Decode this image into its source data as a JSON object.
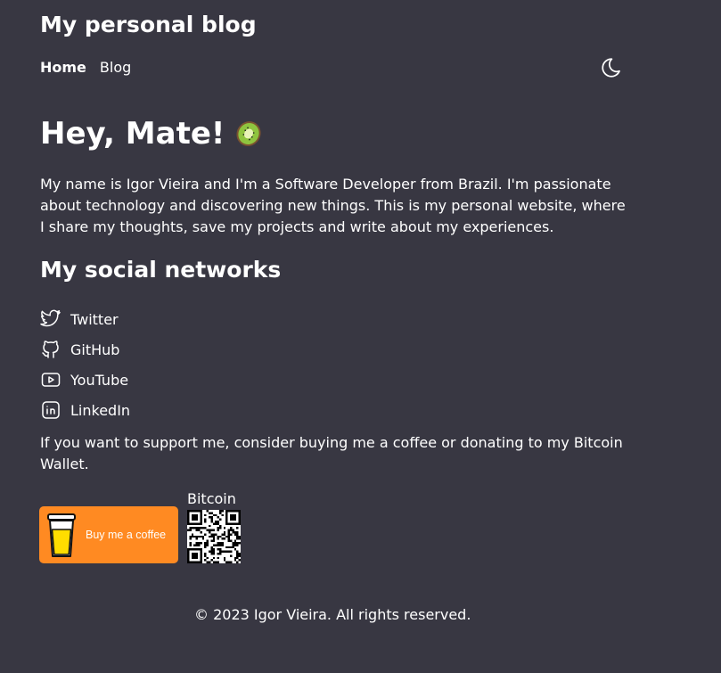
{
  "header": {
    "site_title": "My personal blog",
    "nav": [
      {
        "label": "Home",
        "active": true
      },
      {
        "label": "Blog",
        "active": false
      }
    ],
    "theme_toggle_icon": "moon-icon"
  },
  "hero": {
    "title": "Hey, Mate!",
    "emoji_icon": "kiwi-icon",
    "intro": "My name is Igor Vieira and I'm a Software Developer from Brazil. I'm passionate about technology and discovering new things. This is my personal website, where I share my thoughts, save my projects and write about my experiences."
  },
  "social": {
    "title": "My social networks",
    "items": [
      {
        "label": "Twitter",
        "icon": "twitter-icon"
      },
      {
        "label": "GitHub",
        "icon": "github-icon"
      },
      {
        "label": "YouTube",
        "icon": "youtube-icon"
      },
      {
        "label": "LinkedIn",
        "icon": "linkedin-icon"
      }
    ]
  },
  "support": {
    "text": "If you want to support me, consider buying me a coffee or donating to my Bitcoin Wallet.",
    "bmc_label": "Buy me a coffee",
    "bitcoin_label": "Bitcoin"
  },
  "footer": {
    "text": "© 2023 Igor Vieira. All rights reserved."
  },
  "colors": {
    "background": "#383742",
    "text": "#ffffff",
    "bmc_orange": "#ff8a22"
  }
}
